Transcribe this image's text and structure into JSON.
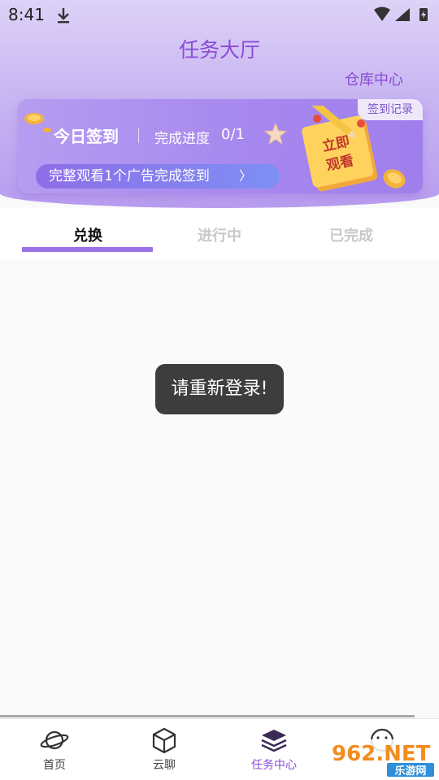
{
  "status_bar": {
    "time": "8:41"
  },
  "header": {
    "title": "任务大厅",
    "warehouse_link": "仓库中心"
  },
  "checkin_card": {
    "record_tag": "签到记录",
    "today_label": "今日签到",
    "progress_label": "完成进度",
    "progress_value": "0/1",
    "watch_button": "完整观看1个广告完成签到",
    "watch_chevron": "〉",
    "art_text_line1": "立即",
    "art_text_line2": "观看"
  },
  "tabs": [
    {
      "label": "兑换",
      "active": true
    },
    {
      "label": "进行中",
      "active": false
    },
    {
      "label": "已完成",
      "active": false
    }
  ],
  "toast": {
    "message": "请重新登录!"
  },
  "bottom_nav": [
    {
      "label": "首页",
      "icon": "planet-icon"
    },
    {
      "label": "云聊",
      "icon": "cube-icon"
    },
    {
      "label": "任务中心",
      "icon": "layers-icon",
      "active": true
    },
    {
      "label": "",
      "icon": "smiley-icon"
    }
  ],
  "watermark": {
    "brand": "962.NET",
    "sub": "乐游网"
  },
  "colors": {
    "accent": "#8a4bd6",
    "tab_underline": "#9b71e8",
    "toast_bg": "#3d3d3d"
  }
}
